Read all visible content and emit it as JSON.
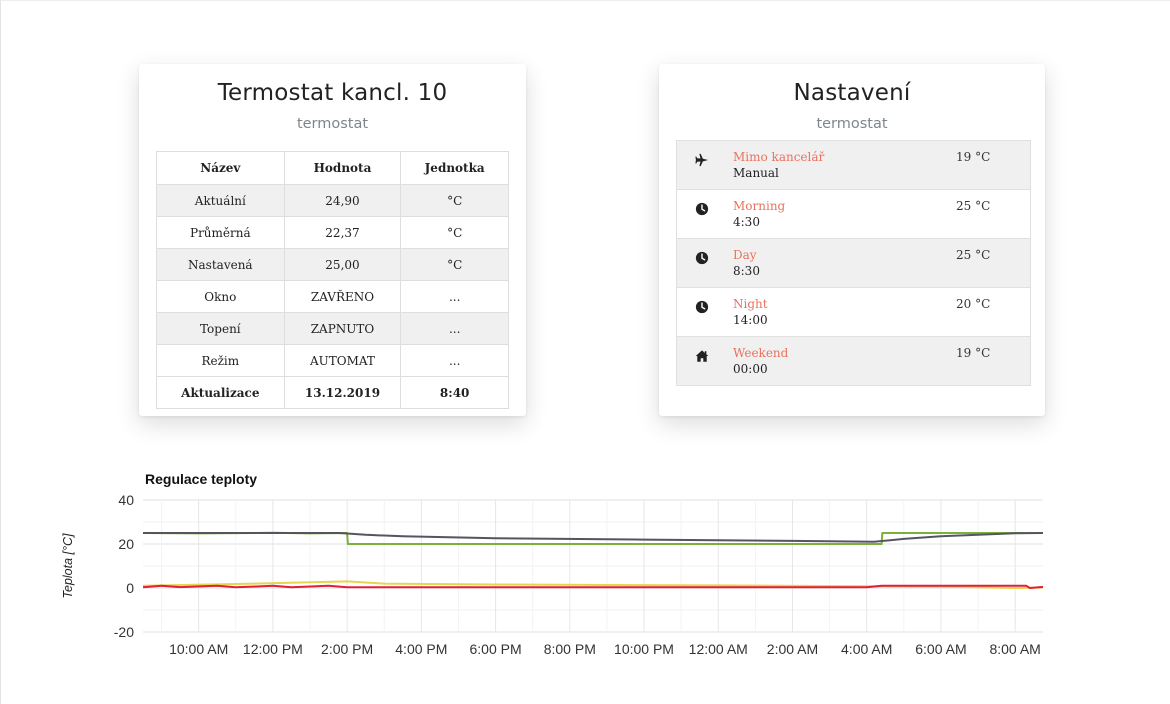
{
  "thermostat": {
    "title": "Termostat kancl. 10",
    "subtitle": "termostat",
    "headers": [
      "Název",
      "Hodnota",
      "Jednotka"
    ],
    "rows": [
      [
        "Aktuální",
        "24,90",
        "°C"
      ],
      [
        "Průměrná",
        "22,37",
        "°C"
      ],
      [
        "Nastavená",
        "25,00",
        "°C"
      ],
      [
        "Okno",
        "ZAVŘENO",
        "..."
      ],
      [
        "Topení",
        "ZAPNUTO",
        "..."
      ],
      [
        "Režim",
        "AUTOMAT",
        "..."
      ],
      [
        "Aktualizace",
        "13.12.2019",
        "8:40"
      ]
    ]
  },
  "settings": {
    "title": "Nastavení",
    "subtitle": "termostat",
    "items": [
      {
        "icon": "airplane-icon",
        "name": "Mimo kancelář",
        "time": "Manual",
        "temp": "19 °C"
      },
      {
        "icon": "clock-icon",
        "name": "Morning",
        "time": "4:30",
        "temp": "25 °C"
      },
      {
        "icon": "clock-icon",
        "name": "Day",
        "time": "8:30",
        "temp": "25 °C"
      },
      {
        "icon": "clock-icon",
        "name": "Night",
        "time": "14:00",
        "temp": "20 °C"
      },
      {
        "icon": "home-icon",
        "name": "Weekend",
        "time": "00:00",
        "temp": "19 °C"
      }
    ]
  },
  "chart_data": {
    "type": "line",
    "title": "Regulace teploty",
    "ylabel": "Teplota [°C]",
    "xlabel": "",
    "ylim": [
      -20,
      40
    ],
    "yticks": [
      40,
      20,
      0,
      -20
    ],
    "xlim": [
      8.5,
      32.75
    ],
    "xtick_values": [
      10,
      12,
      14,
      16,
      18,
      20,
      22,
      24,
      26,
      28,
      30,
      32
    ],
    "xticks": [
      "10:00 AM",
      "12:00 PM",
      "2:00 PM",
      "4:00 PM",
      "6:00 PM",
      "8:00 PM",
      "10:00 PM",
      "12:00 AM",
      "2:00 AM",
      "4:00 AM",
      "6:00 AM",
      "8:00 AM"
    ],
    "grid": true,
    "legend": "none",
    "series": [
      {
        "color": "#7bb03a",
        "points": [
          [
            8.5,
            25
          ],
          [
            10,
            24.8
          ],
          [
            12,
            25.1
          ],
          [
            13,
            24.8
          ],
          [
            14,
            25
          ],
          [
            14.02,
            20
          ],
          [
            28.4,
            20
          ],
          [
            28.42,
            25
          ],
          [
            32.75,
            25
          ]
        ]
      },
      {
        "color": "#555560",
        "points": [
          [
            8.5,
            25
          ],
          [
            13.8,
            25
          ],
          [
            14.5,
            24.2
          ],
          [
            15.5,
            23.5
          ],
          [
            18,
            22.6
          ],
          [
            22,
            22
          ],
          [
            26,
            21.4
          ],
          [
            28.2,
            21
          ],
          [
            29,
            22.3
          ],
          [
            30,
            23.5
          ],
          [
            32,
            24.9
          ],
          [
            32.75,
            25
          ]
        ]
      },
      {
        "color": "#e8d44d",
        "points": [
          [
            8.5,
            1
          ],
          [
            11.5,
            2
          ],
          [
            14,
            3
          ],
          [
            15,
            2
          ],
          [
            18,
            1.6
          ],
          [
            24,
            1.2
          ],
          [
            30,
            0.6
          ],
          [
            32,
            0
          ],
          [
            32.75,
            0.2
          ]
        ]
      },
      {
        "color": "#e0203a",
        "points": [
          [
            8.5,
            0.3
          ],
          [
            9,
            1
          ],
          [
            9.5,
            0.4
          ],
          [
            10.5,
            1
          ],
          [
            11,
            0.3
          ],
          [
            12,
            1
          ],
          [
            12.5,
            0.3
          ],
          [
            13.5,
            1
          ],
          [
            14,
            0.3
          ],
          [
            28,
            0.3
          ],
          [
            28.4,
            1
          ],
          [
            32.3,
            1
          ],
          [
            32.4,
            0
          ],
          [
            32.75,
            0.5
          ]
        ]
      }
    ]
  }
}
